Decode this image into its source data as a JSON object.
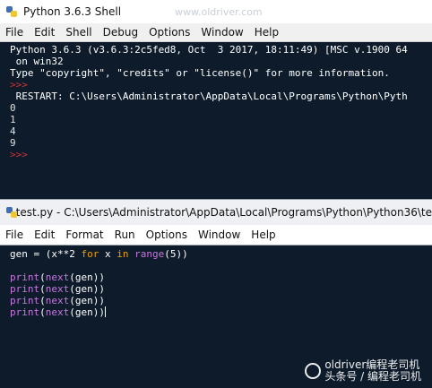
{
  "shell": {
    "title": "Python 3.6.3 Shell",
    "watermark_text": "www.oldriver.com",
    "menu": [
      "File",
      "Edit",
      "Shell",
      "Debug",
      "Options",
      "Window",
      "Help"
    ],
    "console": {
      "line1": "Python 3.6.3 (v3.6.3:2c5fed8, Oct  3 2017, 18:11:49) [MSC v.1900 64",
      "line2": " on win32",
      "line3": "Type \"copyright\", \"credits\" or \"license()\" for more information.",
      "prompt": ">>>",
      "restart": " RESTART: C:\\Users\\Administrator\\AppData\\Local\\Programs\\Python\\Pyth",
      "outputs": [
        "0",
        "1",
        "4",
        "9"
      ]
    }
  },
  "editor": {
    "title": "test.py - C:\\Users\\Administrator\\AppData\\Local\\Programs\\Python\\Python36\\te",
    "menu": [
      "File",
      "Edit",
      "Format",
      "Run",
      "Options",
      "Window",
      "Help"
    ],
    "code": {
      "gen_prefix": "gen = (x**2 ",
      "for_kw": "for",
      "x_var": " x ",
      "in_kw": "in",
      "range_fn": "range",
      "range_args": "(5))",
      "print_fn": "print",
      "next_fn": "next",
      "gen_arg": "(gen))"
    }
  },
  "watermark": {
    "text": "头条号 / 编程老司机",
    "brand": "oldriver编程老司机"
  }
}
